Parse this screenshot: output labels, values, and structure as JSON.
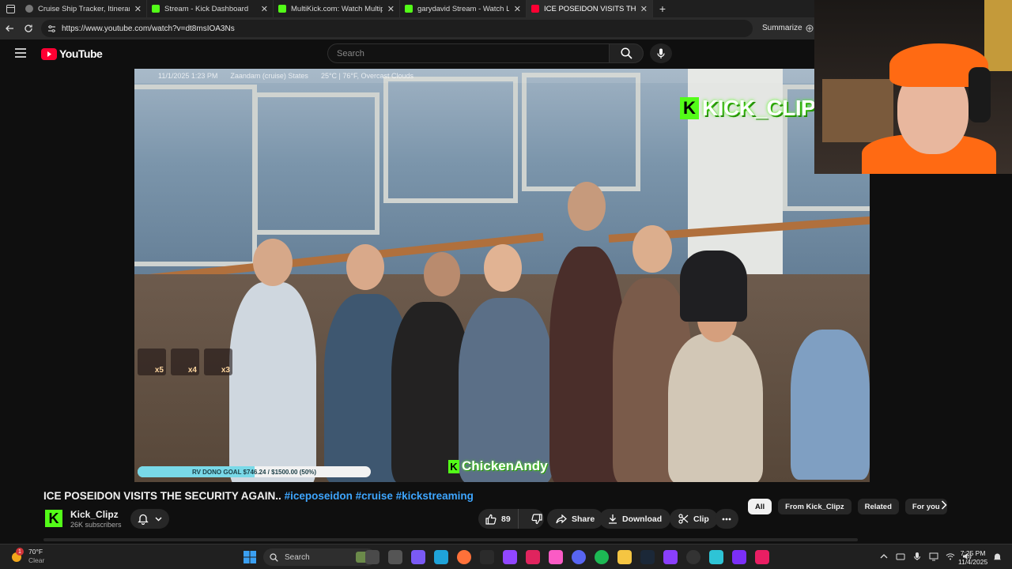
{
  "browser": {
    "tabs": [
      {
        "label": "Cruise Ship Tracker, Itineraries, Sc",
        "favicon": "globe-icon",
        "color": "#777777",
        "active": false
      },
      {
        "label": "Stream - Kick Dashboard",
        "favicon": "kick-icon",
        "color": "#53fc18",
        "active": false
      },
      {
        "label": "MultiKick.com: Watch Multiple St",
        "favicon": "multikick-icon",
        "color": "#53fc18",
        "active": false
      },
      {
        "label": "garydavid Stream - Watch Live o",
        "favicon": "kick-icon",
        "color": "#53fc18",
        "active": false
      },
      {
        "label": "ICE POSEIDON VISITS THE SECUR",
        "favicon": "youtube-icon",
        "color": "#ff0033",
        "active": true
      }
    ],
    "url": "https://www.youtube.com/watch?v=dt8msIOA3Ns",
    "summarize_label": "Summarize"
  },
  "youtube": {
    "logo_text": "YouTube",
    "search_placeholder": "Search"
  },
  "video": {
    "info_strip": [
      "11/1/2025 1:23 PM",
      "Zaandam (cruise) States",
      "25°C | 76°F, Overcast Clouds"
    ],
    "watermark": "KICK_CLIP",
    "streamer_tag": "ChickenAndy",
    "donation_goal": {
      "label": "RV DONO GOAL $746.24 / $1500.00 (50%)",
      "progress": 0.5
    },
    "multipliers": [
      "x5",
      "x4",
      "x3"
    ]
  },
  "below": {
    "title_main": "ICE POSEIDON VISITS THE SECURITY AGAIN..",
    "title_tags": "#iceposeidon #cruise #kickstreaming",
    "channel_name": "Kick_Clipz",
    "subscribers": "26K subscribers",
    "likes": "89",
    "share_label": "Share",
    "download_label": "Download",
    "clip_label": "Clip",
    "chips": [
      "All",
      "From Kick_Clipz",
      "Related",
      "For you"
    ]
  },
  "taskbar": {
    "weather_temp": "70°F",
    "weather_cond": "Clear",
    "weather_badge": "1",
    "search_label": "Search",
    "time": "7:25 PM",
    "date": "11/4/2025"
  },
  "colors": {
    "kick_green": "#53fc18",
    "youtube_red": "#ff0033",
    "link_blue": "#3ea6ff",
    "background": "#0f0f0f"
  }
}
